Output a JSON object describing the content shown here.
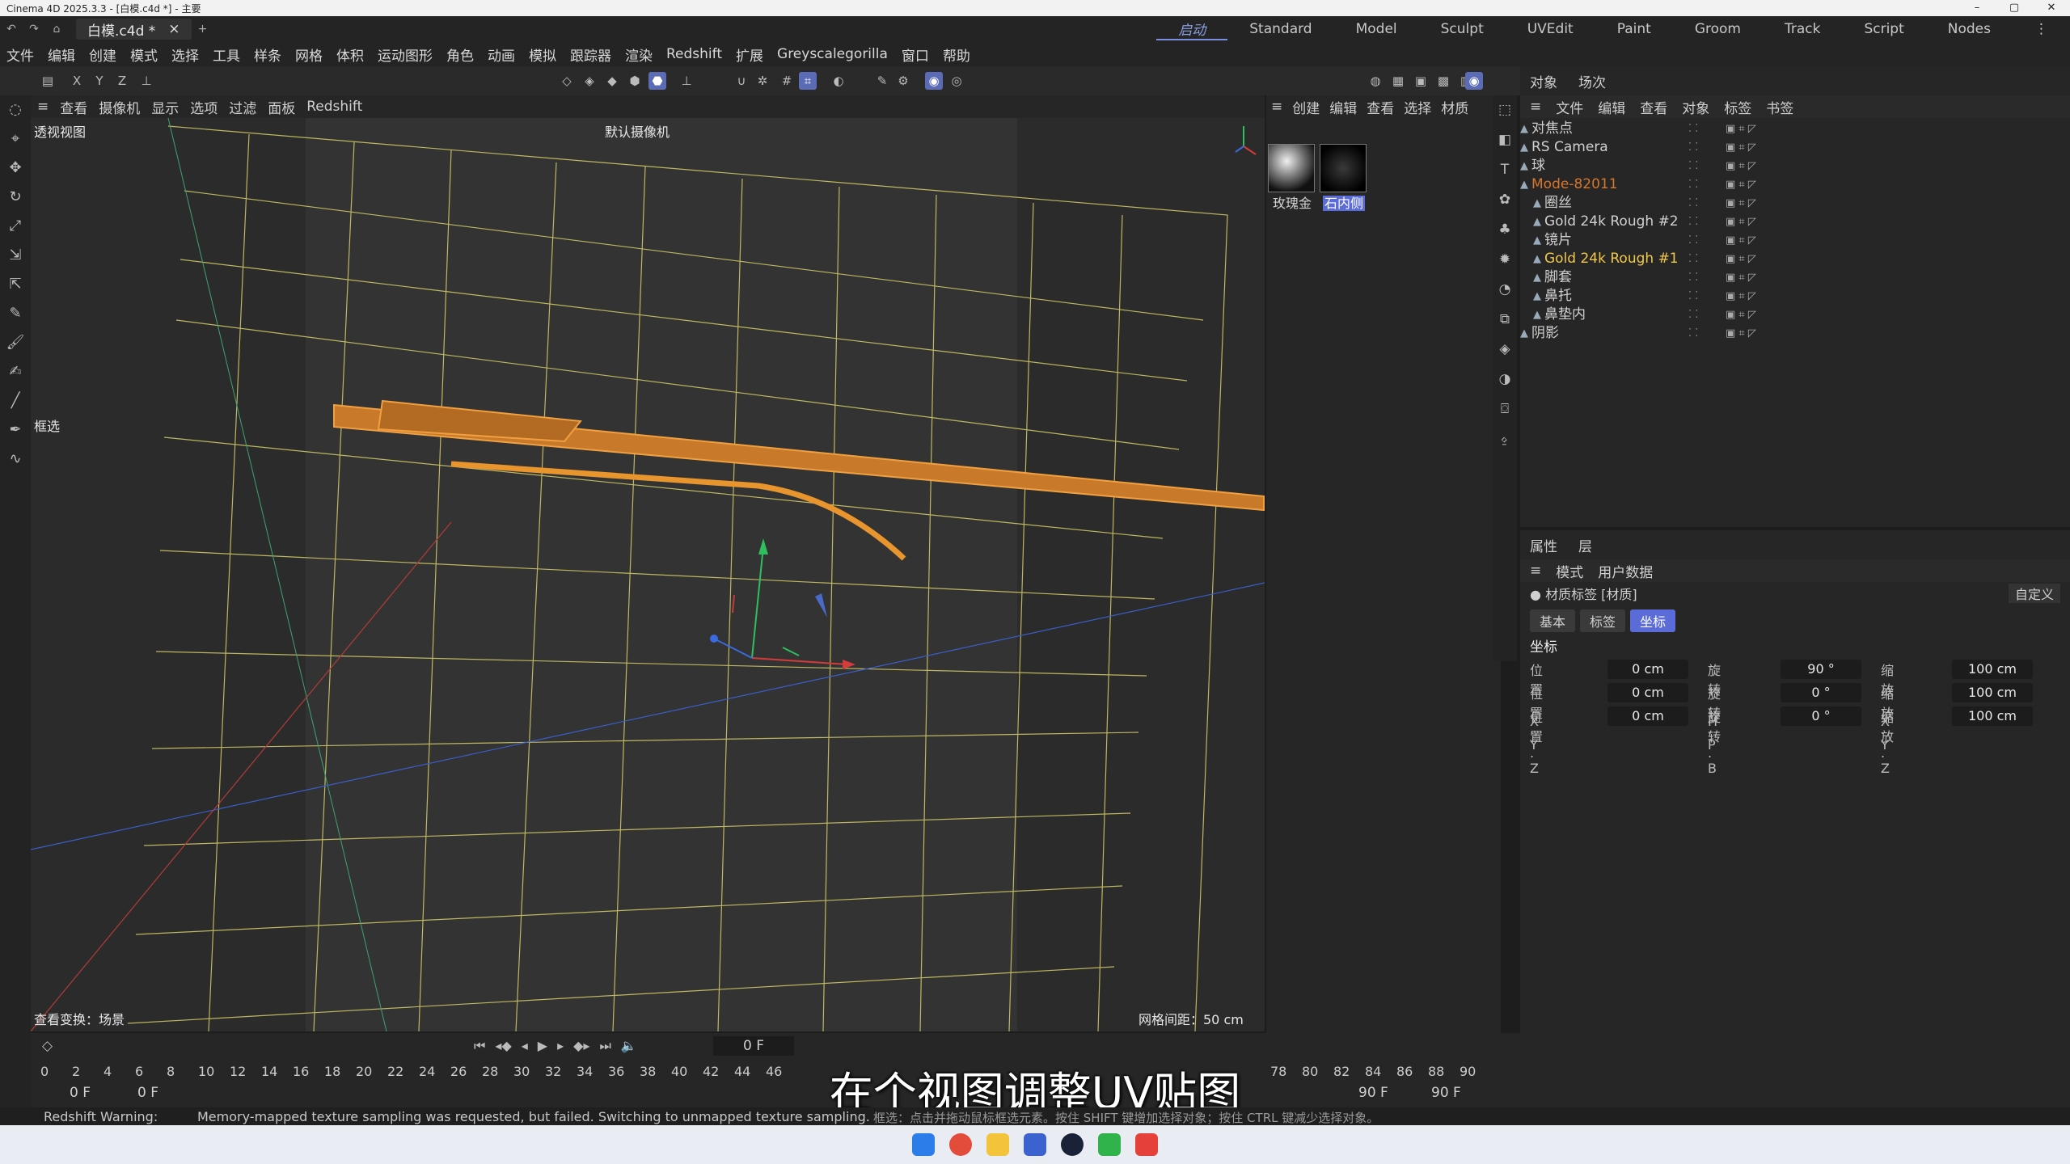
{
  "window": {
    "title": "Cinema 4D 2025.3.3 - [白模.c4d *] - 主要"
  },
  "tabs": {
    "doc_name": "白模.c4d *",
    "close": "×",
    "add": "+"
  },
  "layouts": [
    "启动",
    "Standard",
    "Model",
    "Sculpt",
    "UVEdit",
    "Paint",
    "Groom",
    "Track",
    "Script",
    "Nodes"
  ],
  "menu": [
    "文件",
    "编辑",
    "创建",
    "模式",
    "选择",
    "工具",
    "样条",
    "网格",
    "体积",
    "运动图形",
    "角色",
    "动画",
    "模拟",
    "跟踪器",
    "渲染",
    "Redshift",
    "扩展",
    "Greyscalegorilla",
    "窗口",
    "帮助"
  ],
  "axes": [
    "X",
    "Y",
    "Z"
  ],
  "viewport_menu": [
    "查看",
    "摄像机",
    "显示",
    "选项",
    "过滤",
    "面板",
    "Redshift"
  ],
  "viewport": {
    "name": "透视视图",
    "camera": "默认摄像机",
    "box_select": "框选",
    "view_transform": "查看变换：场景",
    "grid_spacing": "网格间距：50 cm"
  },
  "material_menu": [
    "创建",
    "编辑",
    "查看",
    "选择",
    "材质"
  ],
  "materials": [
    {
      "name": "玫瑰金",
      "selected": false
    },
    {
      "name": "石内侧",
      "selected": true
    }
  ],
  "object_tabs": [
    "对象",
    "场次"
  ],
  "object_menu": [
    "文件",
    "编辑",
    "查看",
    "对象",
    "标签",
    "书签"
  ],
  "objects": [
    {
      "name": "对焦点",
      "level": 0,
      "color": "#d0d0d0"
    },
    {
      "name": "RS Camera",
      "level": 0,
      "color": "#d0d0d0"
    },
    {
      "name": "球",
      "level": 0,
      "color": "#d0d0d0"
    },
    {
      "name": "Mode-82011",
      "level": 0,
      "color": "#d6772c"
    },
    {
      "name": "圈丝",
      "level": 1,
      "color": "#d0d0d0"
    },
    {
      "name": "Gold 24k Rough #2",
      "level": 1,
      "color": "#d0d0d0"
    },
    {
      "name": "镜片",
      "level": 1,
      "color": "#d0d0d0"
    },
    {
      "name": "Gold 24k Rough #1",
      "level": 1,
      "color": "#f0c84a"
    },
    {
      "name": "脚套",
      "level": 1,
      "color": "#d0d0d0"
    },
    {
      "name": "鼻托",
      "level": 1,
      "color": "#d0d0d0"
    },
    {
      "name": "鼻垫内",
      "level": 1,
      "color": "#d0d0d0"
    },
    {
      "name": "阴影",
      "level": 0,
      "color": "#d0d0d0"
    }
  ],
  "attr_tabs": [
    "属性",
    "层"
  ],
  "attr_menu": [
    "模式",
    "用户数据"
  ],
  "attr": {
    "title": "材质标签 [材质]",
    "preset": "自定义",
    "subtabs": [
      "基本",
      "标签",
      "坐标"
    ],
    "section": "坐标",
    "rows": [
      {
        "pl": "位置 . X",
        "pv": "0 cm",
        "rl": "旋转 . H",
        "rv": "90 °",
        "sl": "缩放 . X",
        "sv": "100 cm"
      },
      {
        "pl": "位置 . Y",
        "pv": "0 cm",
        "rl": "旋转 . P",
        "rv": "0 °",
        "sl": "缩放 . Y",
        "sv": "100 cm"
      },
      {
        "pl": "位置 . Z",
        "pv": "0 cm",
        "rl": "旋转 . B",
        "rv": "0 °",
        "sl": "缩放 . Z",
        "sv": "100 cm"
      }
    ]
  },
  "timeline": {
    "current_frame": "0 F",
    "ruler": [
      "0",
      "2",
      "4",
      "6",
      "8",
      "10",
      "12",
      "14",
      "16",
      "18",
      "20",
      "22",
      "24",
      "26",
      "28",
      "30",
      "32",
      "34",
      "36",
      "38",
      "40",
      "42",
      "44",
      "46",
      "78",
      "80",
      "82",
      "84",
      "86",
      "88",
      "90"
    ],
    "start": "0 F",
    "start2": "0 F",
    "end": "90 F",
    "end2": "90 F"
  },
  "subtitle": "在个视图调整UV贴图",
  "status": {
    "warning_label": "Redshift Warning:",
    "warning_text": "Memory-mapped texture sampling was requested, but failed. Switching to unmapped texture sampling.",
    "hint": "框选：点击并拖动鼠标框选元素。按住 SHIFT 键增加选择对象；按住 CTRL 键减少选择对象。"
  },
  "colors": {
    "accent": "#5b6bd8",
    "selection_orange": "#e8952e",
    "grid_yellow": "#d8cf6a"
  }
}
